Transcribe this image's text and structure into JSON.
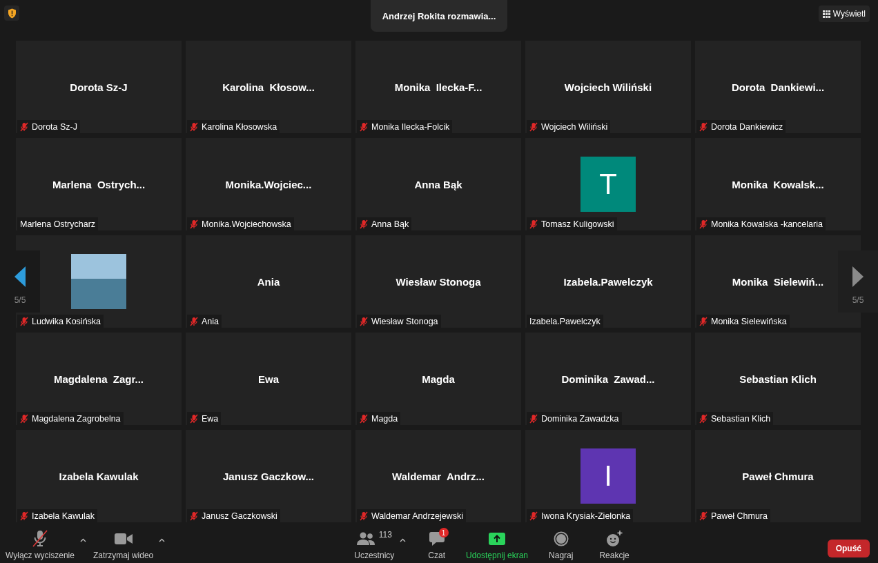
{
  "top_bar": {
    "speaker_banner": "Andrzej Rokita rozmawia...",
    "view_button": "Wyświetl"
  },
  "pager": {
    "previous": {
      "label": "5/5",
      "highlighted": true
    },
    "next": {
      "label": "5/5",
      "highlighted": false
    }
  },
  "tiles": [
    {
      "kind": "name",
      "display_name": "Dorota Sz-J",
      "label": "Dorota Sz-J",
      "muted": true
    },
    {
      "kind": "name",
      "display_name": "Karolina  Kłosow...",
      "label": "Karolina Kłosowska",
      "muted": true
    },
    {
      "kind": "name",
      "display_name": "Monika  Ilecka-F...",
      "label": "Monika Ilecka-Folcik",
      "muted": true
    },
    {
      "kind": "name",
      "display_name": "Wojciech Wiliński",
      "label": "Wojciech Wiliński",
      "muted": true
    },
    {
      "kind": "name",
      "display_name": "Dorota  Dankiewi...",
      "label": "Dorota Dankiewicz",
      "muted": true
    },
    {
      "kind": "name",
      "display_name": "Marlena  Ostrych...",
      "label": "Marlena Ostrycharz",
      "muted": false
    },
    {
      "kind": "name",
      "display_name": "Monika.Wojciec...",
      "label": "Monika.Wojciechowska",
      "muted": true
    },
    {
      "kind": "name",
      "display_name": "Anna Bąk",
      "label": "Anna Bąk",
      "muted": true
    },
    {
      "kind": "initial",
      "initial": "T",
      "color": "#00897b",
      "label": "Tomasz Kuligowski",
      "muted": true
    },
    {
      "kind": "name",
      "display_name": "Monika  Kowalsk...",
      "label": "Monika Kowalska -kancelaria",
      "muted": true
    },
    {
      "kind": "photo",
      "label": "Ludwika Kosińska",
      "muted": true
    },
    {
      "kind": "name",
      "display_name": "Ania",
      "label": "Ania",
      "muted": true
    },
    {
      "kind": "name",
      "display_name": "Wiesław Stonoga",
      "label": "Wiesław Stonoga",
      "muted": true
    },
    {
      "kind": "name",
      "display_name": "Izabela.Pawelczyk",
      "label": "Izabela.Pawelczyk",
      "muted": false
    },
    {
      "kind": "name",
      "display_name": "Monika  Sielewiń...",
      "label": "Monika Sielewińska",
      "muted": true
    },
    {
      "kind": "name",
      "display_name": "Magdalena  Zagr...",
      "label": "Magdalena Zagrobelna",
      "muted": true
    },
    {
      "kind": "name",
      "display_name": "Ewa",
      "label": "Ewa",
      "muted": true
    },
    {
      "kind": "name",
      "display_name": "Magda",
      "label": "Magda",
      "muted": true
    },
    {
      "kind": "name",
      "display_name": "Dominika  Zawad...",
      "label": "Dominika Zawadzka",
      "muted": true
    },
    {
      "kind": "name",
      "display_name": "Sebastian Klich",
      "label": "Sebastian Klich",
      "muted": true
    },
    {
      "kind": "name",
      "display_name": "Izabela Kawulak",
      "label": "Izabela Kawulak",
      "muted": true
    },
    {
      "kind": "name",
      "display_name": "Janusz Gaczkow...",
      "label": "Janusz Gaczkowski",
      "muted": true
    },
    {
      "kind": "name",
      "display_name": "Waldemar  Andrz...",
      "label": "Waldemar Andrzejewski",
      "muted": true
    },
    {
      "kind": "initial",
      "initial": "I",
      "color": "#5e35b1",
      "label": "Iwona Krysiak-Zielonka",
      "muted": true
    },
    {
      "kind": "name",
      "display_name": "Paweł Chmura",
      "label": "Paweł Chmura",
      "muted": true
    }
  ],
  "toolbar": {
    "buttons": [
      {
        "kind": "mic",
        "label": "Wyłącz wyciszenie",
        "muted": true,
        "menu": true
      },
      {
        "kind": "video",
        "label": "Zatrzymaj wideo",
        "menu": true
      },
      {
        "kind": "participants",
        "label": "Uczestnicy",
        "count": "113",
        "menu": true
      },
      {
        "kind": "chat",
        "label": "Czat",
        "badge": "1",
        "menu": false
      },
      {
        "kind": "share",
        "label": "Udostępnij ekran",
        "menu": false
      },
      {
        "kind": "record",
        "label": "Nagraj",
        "menu": false
      },
      {
        "kind": "reactions",
        "label": "Reakcje",
        "menu": false
      }
    ],
    "leave_button": "Opuść"
  }
}
